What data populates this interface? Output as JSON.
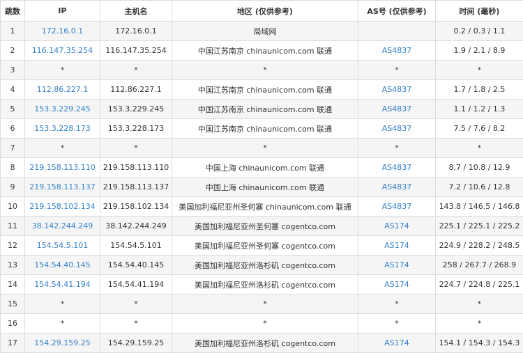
{
  "headers": [
    "跳数",
    "IP",
    "主机名",
    "地区 (仅供参考)",
    "AS号 (仅供参考)",
    "时间 (毫秒)"
  ],
  "rows": [
    {
      "hop": "1",
      "ip": "172.16.0.1",
      "host": "172.16.0.1",
      "loc": "局域网",
      "as": "",
      "time": "0.2 / 0.3 / 1.1"
    },
    {
      "hop": "2",
      "ip": "116.147.35.254",
      "host": "116.147.35.254",
      "loc": "中国江苏南京 chinaunicom.com 联通",
      "as": "AS4837",
      "time": "1.9 / 2.1 / 8.9"
    },
    {
      "hop": "3",
      "ip": "*",
      "host": "*",
      "loc": "*",
      "as": "*",
      "time": "*"
    },
    {
      "hop": "4",
      "ip": "112.86.227.1",
      "host": "112.86.227.1",
      "loc": "中国江苏南京 chinaunicom.com 联通",
      "as": "AS4837",
      "time": "1.7 / 1.8 / 2.5"
    },
    {
      "hop": "5",
      "ip": "153.3.229.245",
      "host": "153.3.229.245",
      "loc": "中国江苏南京 chinaunicom.com 联通",
      "as": "AS4837",
      "time": "1.1 / 1.2 / 1.3"
    },
    {
      "hop": "6",
      "ip": "153.3.228.173",
      "host": "153.3.228.173",
      "loc": "中国江苏南京 chinaunicom.com 联通",
      "as": "AS4837",
      "time": "7.5 / 7.6 / 8.2"
    },
    {
      "hop": "7",
      "ip": "*",
      "host": "*",
      "loc": "*",
      "as": "*",
      "time": "*"
    },
    {
      "hop": "8",
      "ip": "219.158.113.110",
      "host": "219.158.113.110",
      "loc": "中国上海 chinaunicom.com 联通",
      "as": "AS4837",
      "time": "8.7 / 10.8 / 12.9"
    },
    {
      "hop": "9",
      "ip": "219.158.113.137",
      "host": "219.158.113.137",
      "loc": "中国上海 chinaunicom.com 联通",
      "as": "AS4837",
      "time": "7.2 / 10.6 / 12.8"
    },
    {
      "hop": "10",
      "ip": "219.158.102.134",
      "host": "219.158.102.134",
      "loc": "美国加利福尼亚州圣何塞 chinaunicom.com 联通",
      "as": "AS4837",
      "time": "143.8 / 146.5 / 146.8"
    },
    {
      "hop": "11",
      "ip": "38.142.244.249",
      "host": "38.142.244.249",
      "loc": "美国加利福尼亚州圣何塞 cogentco.com",
      "as": "AS174",
      "time": "225.1 / 225.1 / 225.2"
    },
    {
      "hop": "12",
      "ip": "154.54.5.101",
      "host": "154.54.5.101",
      "loc": "美国加利福尼亚州圣何塞 cogentco.com",
      "as": "AS174",
      "time": "224.9 / 228.2 / 248.5"
    },
    {
      "hop": "13",
      "ip": "154.54.40.145",
      "host": "154.54.40.145",
      "loc": "美国加利福尼亚州洛杉矶 cogentco.com",
      "as": "AS174",
      "time": "258 / 267.7 / 268.9"
    },
    {
      "hop": "14",
      "ip": "154.54.41.194",
      "host": "154.54.41.194",
      "loc": "美国加利福尼亚州洛杉矶 cogentco.com",
      "as": "AS174",
      "time": "224.7 / 224.8 / 225.1"
    },
    {
      "hop": "15",
      "ip": "*",
      "host": "*",
      "loc": "*",
      "as": "*",
      "time": "*"
    },
    {
      "hop": "16",
      "ip": "*",
      "host": "*",
      "loc": "*",
      "as": "*",
      "time": "*"
    },
    {
      "hop": "17",
      "ip": "154.29.159.25",
      "host": "154.29.159.25",
      "loc": "美国加利福尼亚州洛杉矶 cogentco.com",
      "as": "AS174",
      "time": "154.1 / 154.3 / 154.3"
    }
  ],
  "colors": {
    "link": "#3380c8",
    "border": "#dcdcdc",
    "row_alt": "#f5f5f5",
    "text": "#333333"
  }
}
